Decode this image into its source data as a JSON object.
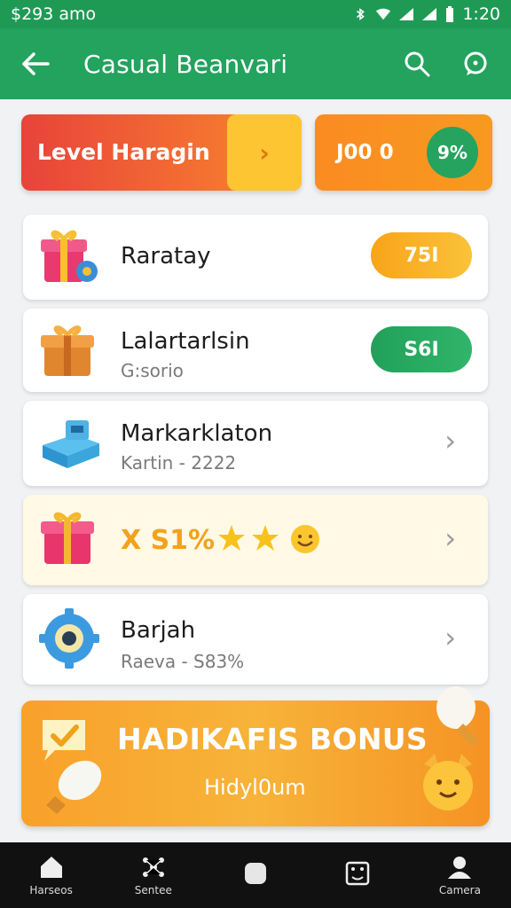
{
  "status_bar": {
    "left_text": "$293 amo",
    "time": "1:20"
  },
  "app_bar": {
    "title": "Casual Beanvari"
  },
  "level_card": {
    "label": "Level Haragin",
    "arrow": "›"
  },
  "score_card": {
    "value": "J00 0",
    "percent": "9%"
  },
  "items": [
    {
      "name": "Raratay",
      "badge": "75I"
    },
    {
      "name": "Lalartarlsin",
      "sub": "G:sorio",
      "badge": "S6I"
    },
    {
      "name": "Markarklaton",
      "sub": "Kartin - 2222"
    },
    {
      "star_text": "X S1%"
    },
    {
      "name": "Barjah",
      "sub": "Raeva - S83%"
    }
  ],
  "bonus": {
    "title": "HADIKAFIS BONUS",
    "subtitle": "Hidyl0um"
  },
  "bottom_nav": [
    {
      "label": "Harseos",
      "icon": "home-icon"
    },
    {
      "label": "Sentee",
      "icon": "network-icon"
    },
    {
      "label": "",
      "icon": "square-icon"
    },
    {
      "label": "",
      "icon": "dice-icon"
    },
    {
      "label": "Camera",
      "icon": "profile-icon"
    }
  ],
  "colors": {
    "primary": "#23a35e",
    "status_bar": "#1f9a55",
    "orange": "#f7882c",
    "yellow": "#fdc531",
    "green_badge": "#26a35f",
    "nav_bg": "#111111"
  }
}
